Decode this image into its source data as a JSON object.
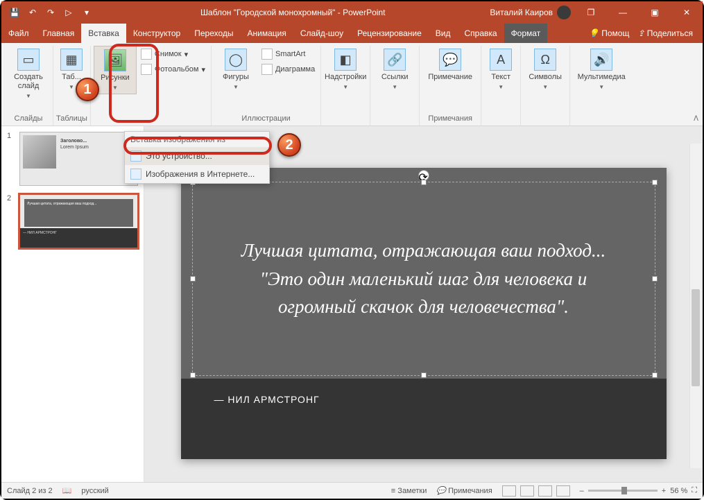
{
  "titlebar": {
    "title": "Шаблон \"Городской монохромный\" - PowerPoint",
    "user": "Виталий Каиров"
  },
  "tabs": {
    "file": "Файл",
    "home": "Главная",
    "insert": "Вставка",
    "design": "Конструктор",
    "transitions": "Переходы",
    "animations": "Анимация",
    "slideshow": "Слайд-шоу",
    "review": "Рецензирование",
    "view": "Вид",
    "help": "Справка",
    "format": "Формат",
    "tell_me": "Помощ",
    "share": "Поделиться"
  },
  "ribbon": {
    "new_slide": "Создать слайд",
    "slides_group": "Слайды",
    "tables": "Таб...",
    "tables_group": "Таблицы",
    "pictures": "Рисунки",
    "screenshot": "Снимок",
    "photoalbum": "Фотоальбом",
    "shapes": "Фигуры",
    "smartart": "SmartArt",
    "chart": "Диаграмма",
    "illustrations_group": "Иллюстрации",
    "addins": "Надстройки",
    "links": "Ссылки",
    "comment": "Примечание",
    "comments_group": "Примечания",
    "text": "Текст",
    "symbols": "Символы",
    "media": "Мультимедиа"
  },
  "dropdown": {
    "header": "Вставка изображения из",
    "this_device": "Это устройство...",
    "online": "Изображения в Интернете..."
  },
  "thumbs": {
    "n1": "1",
    "n2": "2",
    "t1_title": "Заголово...",
    "t1_sub": "Lorem Ipsum"
  },
  "slide": {
    "quote": "Лучшая цитата, отражающая ваш подход... \"Это один маленький шаг для человека и огромный скачок для человечества\".",
    "author": "— НИЛ АРМСТРОНГ"
  },
  "status": {
    "slide_counter": "Слайд 2 из 2",
    "language": "русский",
    "notes": "Заметки",
    "comments": "Примечания",
    "zoom": "56 %"
  },
  "callouts": {
    "c1": "1",
    "c2": "2"
  },
  "glyph": {
    "save": "💾",
    "undo": "↶",
    "redo": "↷",
    "start": "▷",
    "down": "▾",
    "ribbon_min": "ᐱ",
    "restore": "❐",
    "max": "▣",
    "min": "—",
    "close": "✕",
    "bulb": "💡",
    "share": "⇪",
    "dash": "–",
    "plus": "+",
    "fit": "⛶",
    "notes": "≡",
    "comm": "💬"
  }
}
